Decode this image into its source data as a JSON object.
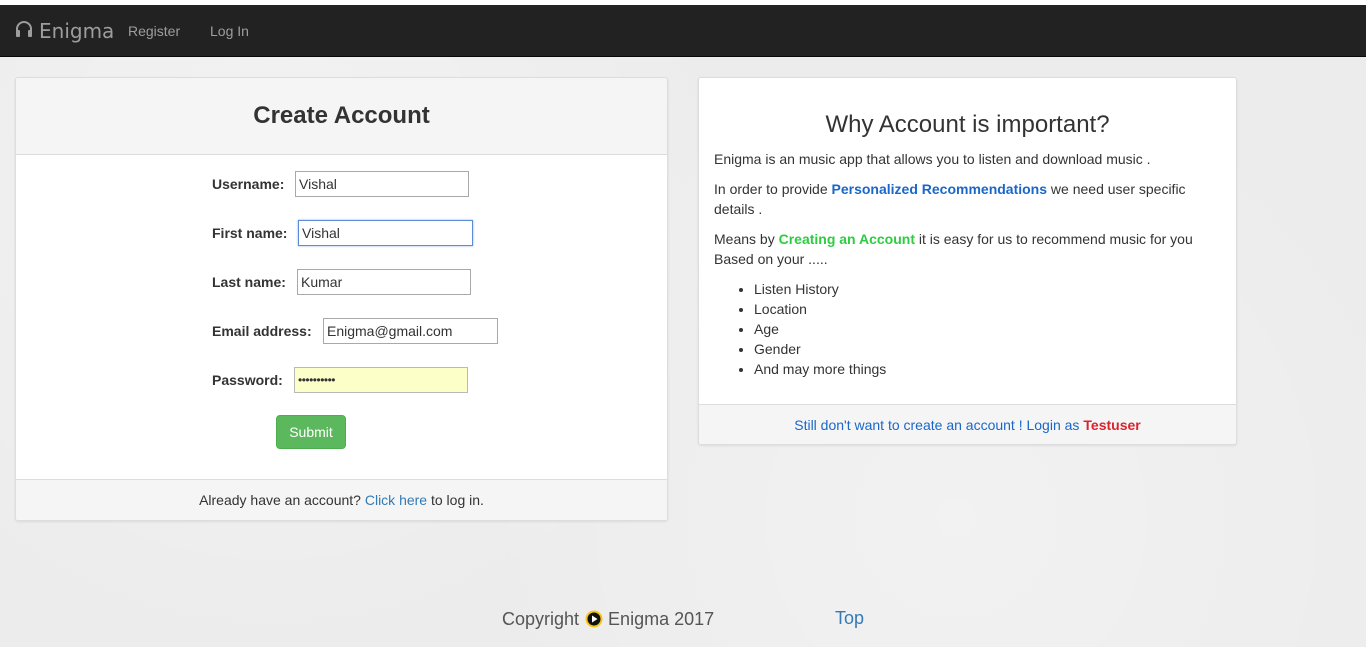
{
  "navbar": {
    "brand": "Enigma",
    "brand_icon": "headphones-icon",
    "links": [
      "Register",
      "Log In"
    ]
  },
  "create_account": {
    "title": "Create Account",
    "fields": [
      {
        "label": "Username:",
        "value": "Vishal"
      },
      {
        "label": "First name:",
        "value": "Vishal"
      },
      {
        "label": "Last name:",
        "value": "Kumar"
      },
      {
        "label": "Email address:",
        "value": "Enigma@gmail.com"
      },
      {
        "label": "Password:",
        "value": "••••••••••"
      }
    ],
    "submit_label": "Submit",
    "footer": {
      "prefix": "Already have an account?",
      "link": "Click here",
      "suffix": "to log in."
    }
  },
  "why_account": {
    "title": "Why Account is important?",
    "p1": "Enigma is an music app that allows you to listen and download music .",
    "p2_prefix": "In order to provide",
    "p2_highlight": "Personalized Recommendations",
    "p2_suffix": "we need user specific details .",
    "p3_prefix": "Means by",
    "p3_highlight": "Creating an Account",
    "p3_suffix": "it is easy for us to recommend music for you Based on your .....",
    "bullets": [
      "Listen History",
      "Location",
      "Age",
      "Gender",
      "And may more things"
    ],
    "footer_text": "Still don't want to create an account ! Login as",
    "footer_user": "Testuser"
  },
  "footer": {
    "copyright_prefix": "Copyright",
    "copyright_suffix": "Enigma 2017",
    "logo_icon": "play-logo-icon",
    "top_link": "Top"
  },
  "colors": {
    "navbar": "#222222",
    "submit": "#5cb85c",
    "link": "#337ab7",
    "highlight_blue": "#1a67c9",
    "highlight_green": "#2ecc40",
    "testuser_red": "#d9232d"
  }
}
